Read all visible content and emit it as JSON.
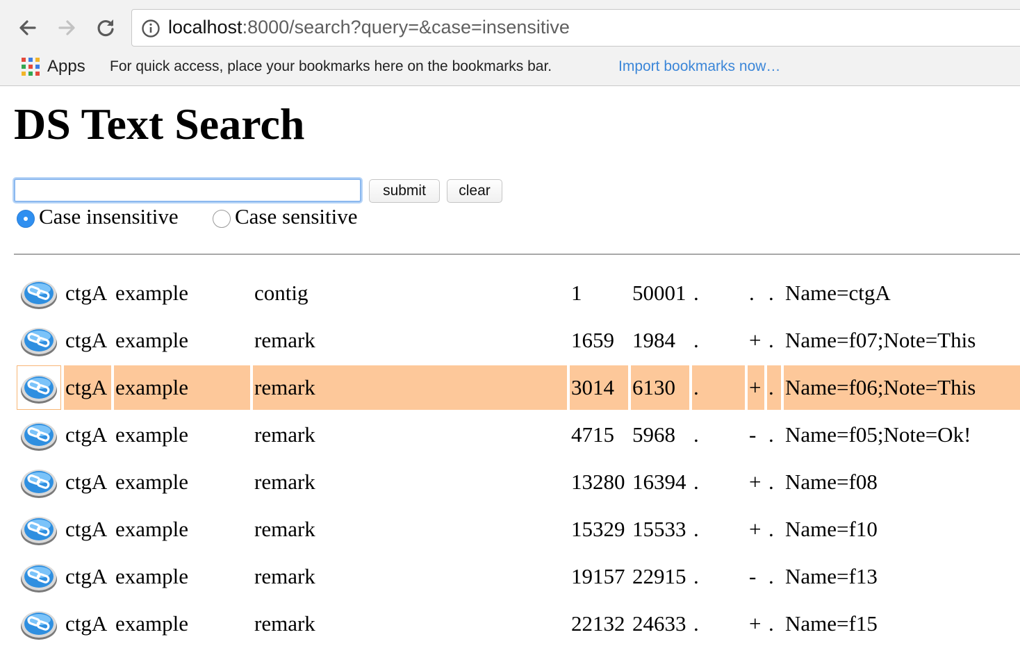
{
  "browser": {
    "url_host": "localhost",
    "url_rest": ":8000/search?query=&case=insensitive",
    "apps_label": "Apps",
    "bookmarks_hint": "For quick access, place your bookmarks here on the bookmarks bar.",
    "import_link": "Import bookmarks now…"
  },
  "page": {
    "title": "DS Text Search",
    "search": {
      "value": "",
      "placeholder": ""
    },
    "submit_label": "submit",
    "clear_label": "clear",
    "case_options": [
      {
        "label": "Case insensitive",
        "selected": true
      },
      {
        "label": "Case sensitive",
        "selected": false
      }
    ]
  },
  "results": {
    "highlighted_row": 2,
    "rows": [
      {
        "seqid": "ctgA",
        "source": "example",
        "type": "contig",
        "start": "1",
        "end": "50001",
        "score": ".",
        "strand": ".",
        "phase": ".",
        "attributes": "Name=ctgA"
      },
      {
        "seqid": "ctgA",
        "source": "example",
        "type": "remark",
        "start": "1659",
        "end": "1984",
        "score": ".",
        "strand": "+",
        "phase": ".",
        "attributes": "Name=f07;Note=This"
      },
      {
        "seqid": "ctgA",
        "source": "example",
        "type": "remark",
        "start": "3014",
        "end": "6130",
        "score": ".",
        "strand": "+",
        "phase": ".",
        "attributes": "Name=f06;Note=This"
      },
      {
        "seqid": "ctgA",
        "source": "example",
        "type": "remark",
        "start": "4715",
        "end": "5968",
        "score": ".",
        "strand": "-",
        "phase": ".",
        "attributes": "Name=f05;Note=Ok!"
      },
      {
        "seqid": "ctgA",
        "source": "example",
        "type": "remark",
        "start": "13280",
        "end": "16394",
        "score": ".",
        "strand": "+",
        "phase": ".",
        "attributes": "Name=f08"
      },
      {
        "seqid": "ctgA",
        "source": "example",
        "type": "remark",
        "start": "15329",
        "end": "15533",
        "score": ".",
        "strand": "+",
        "phase": ".",
        "attributes": "Name=f10"
      },
      {
        "seqid": "ctgA",
        "source": "example",
        "type": "remark",
        "start": "19157",
        "end": "22915",
        "score": ".",
        "strand": "-",
        "phase": ".",
        "attributes": "Name=f13"
      },
      {
        "seqid": "ctgA",
        "source": "example",
        "type": "remark",
        "start": "22132",
        "end": "24633",
        "score": ".",
        "strand": "+",
        "phase": ".",
        "attributes": "Name=f15"
      }
    ]
  },
  "colors": {
    "highlight": "#fdc89a",
    "link": "#3b86d8",
    "radio_selected": "#2f8ff0"
  },
  "icons": [
    "back-arrow-icon",
    "forward-arrow-icon",
    "reload-icon",
    "info-icon",
    "apps-grid-icon",
    "link-icon"
  ]
}
